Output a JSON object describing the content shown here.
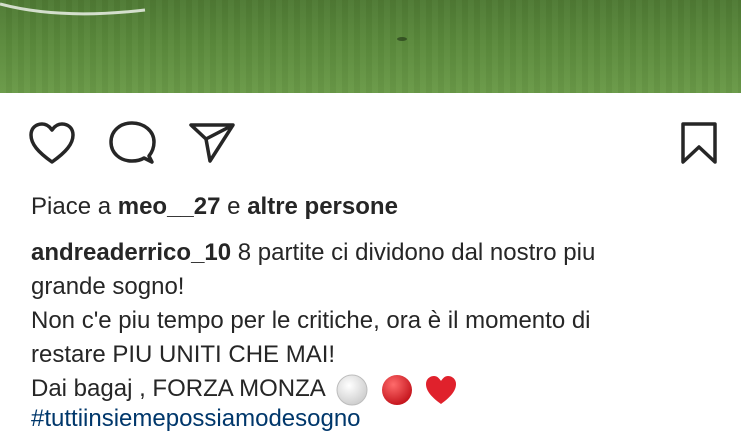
{
  "post": {
    "image_alt": "football pitch"
  },
  "actions": {
    "like_icon": "heart-icon",
    "comment_icon": "comment-icon",
    "share_icon": "send-icon",
    "save_icon": "bookmark-icon"
  },
  "likes": {
    "prefix": "Piace a",
    "user": "meo__27",
    "connector": "e",
    "others": "altre persone"
  },
  "caption": {
    "username": "andreaderrico_10",
    "line1_text": "8 partite ci dividono dal nostro piu",
    "line2": "grande sogno!",
    "line3": "Non c'e piu tempo per le critiche, ora è il momento di",
    "line4": "restare PIU UNITI CHE MAI!",
    "line5": "Dai bagaj , FORZA MONZA",
    "emojis": [
      "white-circle-icon",
      "red-circle-icon",
      "red-heart-icon"
    ]
  },
  "hashtags": {
    "text": "#tuttiinsiemepossiamodesogno"
  },
  "colors": {
    "text": "#262626",
    "link": "#00376b",
    "red": "#e0212c",
    "heart": "#e0212c"
  }
}
